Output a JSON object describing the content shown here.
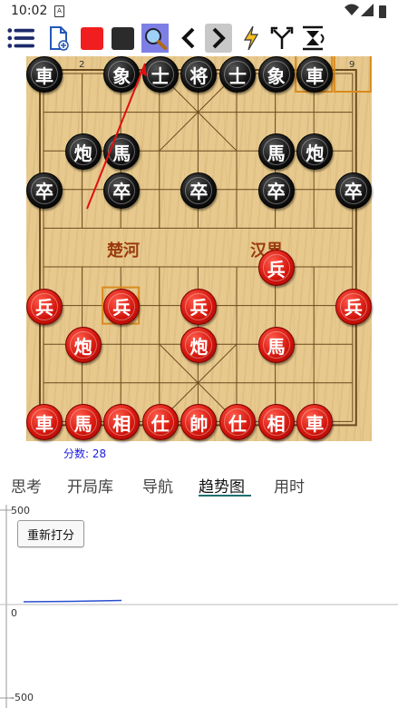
{
  "status_bar": {
    "time": "10:02",
    "sim_label": "A"
  },
  "toolbar": {
    "icons": [
      "menu-icon",
      "new-file-icon",
      "red-square-icon",
      "black-square-icon",
      "search-icon",
      "prev-icon",
      "next-icon",
      "lightning-icon",
      "branch-icon",
      "flip-icon"
    ]
  },
  "board": {
    "top_numbers": {
      "col2": "2",
      "col9": "9"
    },
    "river_left": "楚河",
    "river_right": "汉界",
    "pieces": [
      {
        "t": "車",
        "c": "black",
        "col": 1,
        "row": 1
      },
      {
        "t": "象",
        "c": "black",
        "col": 3,
        "row": 1
      },
      {
        "t": "士",
        "c": "black",
        "col": 4,
        "row": 1
      },
      {
        "t": "将",
        "c": "black",
        "col": 5,
        "row": 1
      },
      {
        "t": "士",
        "c": "black",
        "col": 6,
        "row": 1
      },
      {
        "t": "象",
        "c": "black",
        "col": 7,
        "row": 1
      },
      {
        "t": "車",
        "c": "black",
        "col": 8,
        "row": 1
      },
      {
        "t": "炮",
        "c": "black",
        "col": 2,
        "row": 3
      },
      {
        "t": "馬",
        "c": "black",
        "col": 3,
        "row": 3
      },
      {
        "t": "馬",
        "c": "black",
        "col": 7,
        "row": 3
      },
      {
        "t": "炮",
        "c": "black",
        "col": 8,
        "row": 3
      },
      {
        "t": "卒",
        "c": "black",
        "col": 1,
        "row": 4
      },
      {
        "t": "卒",
        "c": "black",
        "col": 3,
        "row": 4
      },
      {
        "t": "卒",
        "c": "black",
        "col": 5,
        "row": 4
      },
      {
        "t": "卒",
        "c": "black",
        "col": 7,
        "row": 4
      },
      {
        "t": "卒",
        "c": "black",
        "col": 9,
        "row": 4
      },
      {
        "t": "兵",
        "c": "red",
        "col": 7,
        "row": 6
      },
      {
        "t": "兵",
        "c": "red",
        "col": 1,
        "row": 7
      },
      {
        "t": "兵",
        "c": "red",
        "col": 3,
        "row": 7
      },
      {
        "t": "兵",
        "c": "red",
        "col": 5,
        "row": 7
      },
      {
        "t": "兵",
        "c": "red",
        "col": 9,
        "row": 7
      },
      {
        "t": "炮",
        "c": "red",
        "col": 2,
        "row": 8
      },
      {
        "t": "炮",
        "c": "red",
        "col": 5,
        "row": 8
      },
      {
        "t": "馬",
        "c": "red",
        "col": 7,
        "row": 8
      },
      {
        "t": "車",
        "c": "red",
        "col": 1,
        "row": 10
      },
      {
        "t": "馬",
        "c": "red",
        "col": 2,
        "row": 10
      },
      {
        "t": "相",
        "c": "red",
        "col": 3,
        "row": 10
      },
      {
        "t": "仕",
        "c": "red",
        "col": 4,
        "row": 10
      },
      {
        "t": "帥",
        "c": "red",
        "col": 5,
        "row": 10
      },
      {
        "t": "仕",
        "c": "red",
        "col": 6,
        "row": 10
      },
      {
        "t": "相",
        "c": "red",
        "col": 7,
        "row": 10
      },
      {
        "t": "車",
        "c": "red",
        "col": 8,
        "row": 10
      }
    ],
    "highlight_squares": [
      {
        "col": 8,
        "row": 1
      },
      {
        "col": 9,
        "row": 1
      },
      {
        "col": 3,
        "row": 7
      }
    ],
    "colors": {
      "red_piece": "#d4150c",
      "black_piece": "#111111",
      "highlight": "#d98a1e",
      "arrow": "#e01010"
    }
  },
  "score": {
    "text": "分数: 28"
  },
  "tabs": [
    {
      "label": "思考",
      "active": false
    },
    {
      "label": "开局库",
      "active": false
    },
    {
      "label": "导航",
      "active": false
    },
    {
      "label": "趋势图",
      "active": true
    },
    {
      "label": "用时",
      "active": false
    }
  ],
  "trend": {
    "rescore_button": "重新打分",
    "y_max_label": "500",
    "y_zero_label": "0",
    "y_min_label": "-500",
    "line_color": "#2a4fd0"
  }
}
